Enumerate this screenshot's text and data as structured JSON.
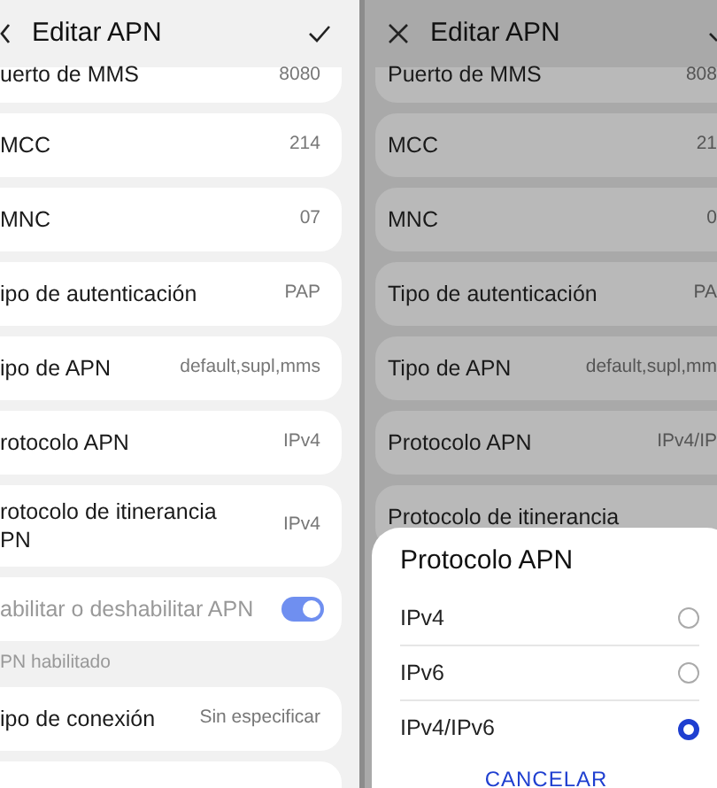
{
  "left_screen": {
    "title": "Editar APN",
    "rows": [
      {
        "label": "uerto de MMS",
        "value": "8080"
      },
      {
        "label": "MCC",
        "value": "214"
      },
      {
        "label": "MNC",
        "value": "07"
      },
      {
        "label": "ipo de autenticación",
        "value": "PAP"
      },
      {
        "label": "ipo de APN",
        "value": "default,supl,mms"
      },
      {
        "label": "rotocolo APN",
        "value": "IPv4"
      },
      {
        "label": "rotocolo de itinerancia\nPN",
        "value": "IPv4"
      }
    ],
    "toggle": {
      "label": "abilitar o deshabilitar APN",
      "on": true
    },
    "section": "PN habilitado",
    "rows_after": [
      {
        "label": "ipo de conexión",
        "value": "Sin especificar"
      }
    ]
  },
  "right_screen": {
    "title": "Editar APN",
    "rows": [
      {
        "label": "Puerto de MMS",
        "value": "808"
      },
      {
        "label": "MCC",
        "value": "21"
      },
      {
        "label": "MNC",
        "value": "0"
      },
      {
        "label": "Tipo de autenticación",
        "value": "PA"
      },
      {
        "label": "Tipo de APN",
        "value": "default,supl,mm"
      },
      {
        "label": "Protocolo APN",
        "value": "IPv4/IP"
      },
      {
        "label": "Protocolo de itinerancia"
      }
    ],
    "sheet": {
      "title": "Protocolo APN",
      "options": [
        {
          "label": "IPv4",
          "selected": false
        },
        {
          "label": "IPv6",
          "selected": false
        },
        {
          "label": "IPv4/IPv6",
          "selected": true
        }
      ],
      "cancel": "CANCELAR"
    }
  }
}
